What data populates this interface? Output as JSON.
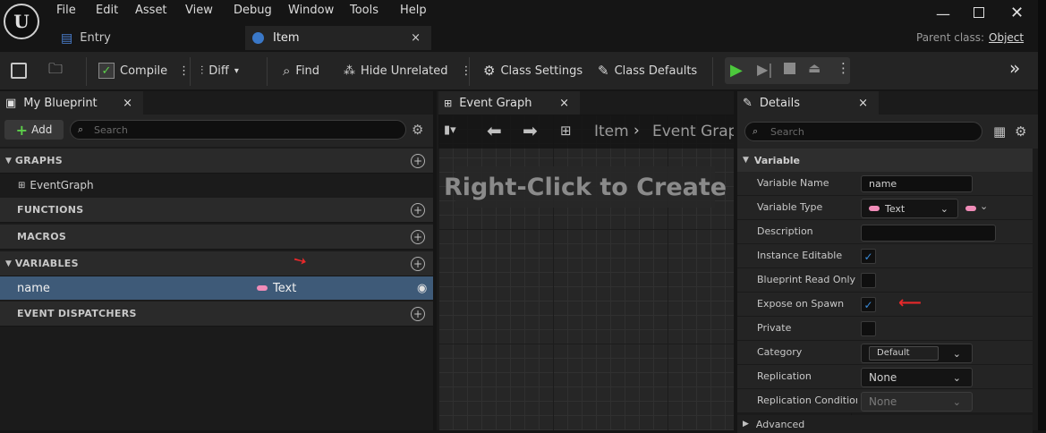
{
  "menu": [
    "File",
    "Edit",
    "Asset",
    "View",
    "Debug",
    "Window",
    "Tools",
    "Help"
  ],
  "tabs": {
    "entry": "Entry",
    "item": "Item"
  },
  "parent_class": {
    "label": "Parent class:",
    "value": "Object"
  },
  "toolbar": {
    "compile": "Compile",
    "diff": "Diff",
    "find": "Find",
    "hide_unrelated": "Hide Unrelated",
    "class_settings": "Class Settings",
    "class_defaults": "Class Defaults"
  },
  "my_blueprint": {
    "title": "My Blueprint",
    "add": "Add",
    "search_placeholder": "Search",
    "graphs": "GRAPHS",
    "event_graph": "EventGraph",
    "functions": "FUNCTIONS",
    "macros": "MACROS",
    "variables": "VARIABLES",
    "var_name": "name",
    "var_type": "Text",
    "event_dispatchers": "EVENT DISPATCHERS"
  },
  "event_graph": {
    "title": "Event Graph",
    "crumb_root": "Item",
    "crumb_child": "Event Grap",
    "hint": "Right-Click to Create"
  },
  "details": {
    "title": "Details",
    "search_placeholder": "Search",
    "section": "Variable",
    "variable_name_label": "Variable Name",
    "variable_name_value": "name",
    "variable_type_label": "Variable Type",
    "variable_type_value": "Text",
    "description_label": "Description",
    "instance_editable_label": "Instance Editable",
    "blueprint_read_only_label": "Blueprint Read Only",
    "expose_on_spawn_label": "Expose on Spawn",
    "private_label": "Private",
    "category_label": "Category",
    "category_value": "Default",
    "replication_label": "Replication",
    "replication_value": "None",
    "replication_condition_label": "Replication Condition",
    "replication_condition_value": "None",
    "advanced": "Advanced"
  },
  "colors": {
    "accent_selected": "#3e5a78",
    "text_type_pin": "#f08cb8",
    "checkbox": "#3a8bd8",
    "annotation_arrow": "#e8282a"
  }
}
